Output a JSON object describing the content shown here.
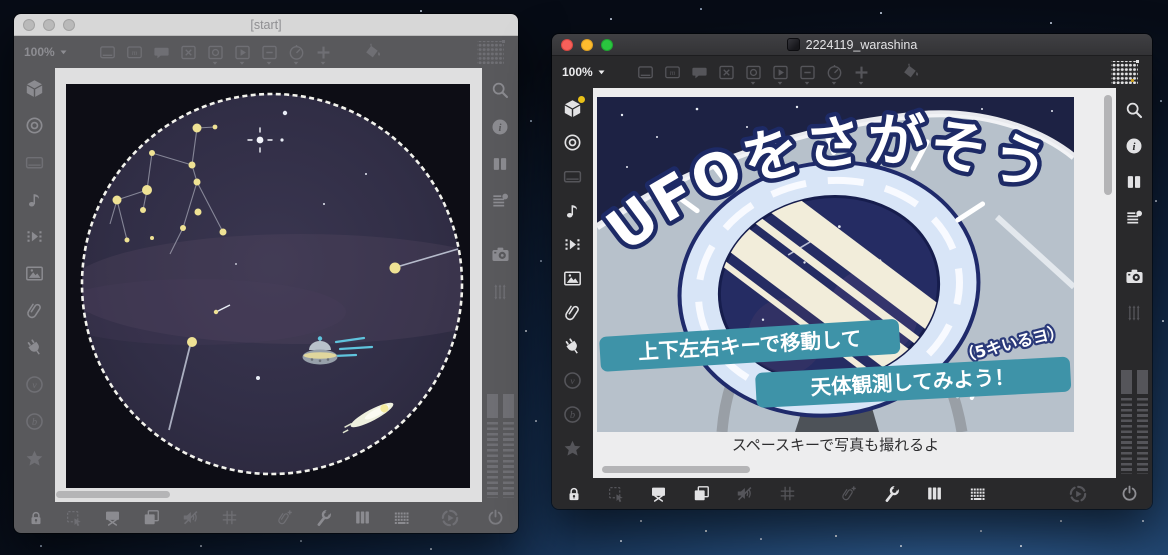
{
  "left_window": {
    "title": "[start]",
    "zoom_level": "100%"
  },
  "right_window": {
    "title": "2224119_warashina",
    "zoom_level": "100%",
    "caption": "スペースキーで写真も撮れるよ"
  },
  "artwork": {
    "title": "UFOをさがそう",
    "count_note": "（5キいるヨ）",
    "instruction_line1": "上下左右キーで移動して",
    "instruction_line2": "天体観測してみよう！"
  },
  "colors": {
    "accent_yellow": "#e9c118",
    "banner_teal": "#3e93a8",
    "sky_navy": "#1d2244",
    "traffic_red": "#f7605a",
    "traffic_yellow": "#fdbc2e",
    "traffic_green": "#2ac63f"
  },
  "icons": {
    "top_toolbar": [
      "zoom-dropdown",
      "screen-icon",
      "m-box-icon",
      "speech-bubble-icon",
      "x-box-icon",
      "circle-box-icon",
      "play-box-icon",
      "minus-box-icon",
      "timer-icon",
      "plus-icon",
      "paint-bucket-icon",
      "pixel-grid-icon"
    ],
    "left_sidebar": [
      "cube-icon",
      "target-icon",
      "monitor-icon",
      "music-note-icon",
      "film-icon",
      "image-icon",
      "paperclip-icon",
      "plug-icon",
      "v-badge-icon",
      "b-badge-icon",
      "star-icon"
    ],
    "right_sidebar": [
      "search-icon",
      "info-icon",
      "columns-icon",
      "list-icon",
      "camera-icon",
      "sliders-icon",
      "fader-bars"
    ],
    "bottom_toolbar": [
      "lock-icon",
      "select-icon",
      "easel-icon",
      "layers-icon",
      "mute-icon",
      "grid-icon",
      "clip-plus-icon",
      "wrench-icon",
      "piano-icon",
      "keyboard-icon",
      "play-circle-icon",
      "power-icon"
    ]
  }
}
